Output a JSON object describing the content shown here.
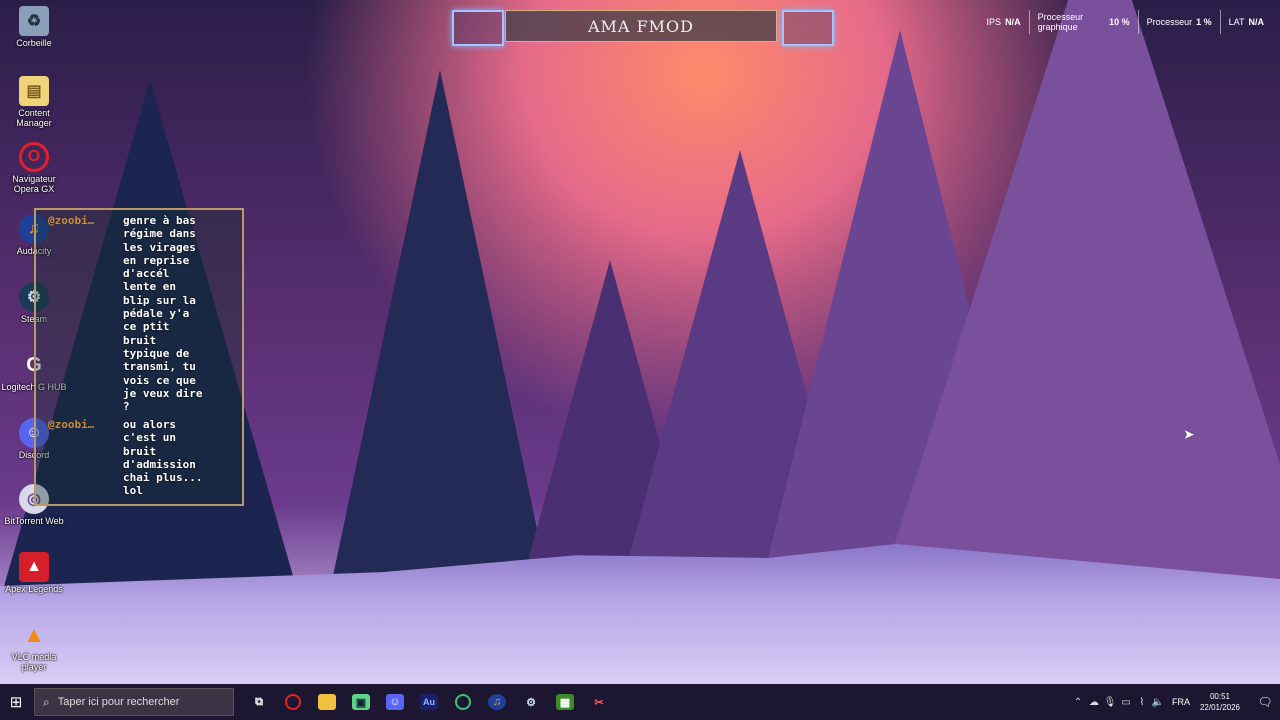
{
  "desktop_icons": [
    {
      "label": "Corbeille",
      "icon": "recycle-bin-icon"
    },
    {
      "label": "Content\nManager",
      "icon": "folder-icon"
    },
    {
      "label": "Navigateur\nOpera GX",
      "icon": "opera-gx-icon"
    },
    {
      "label": "Audacity",
      "icon": "audacity-icon"
    },
    {
      "label": "Steam",
      "icon": "steam-icon"
    },
    {
      "label": "Logitech G HUB",
      "icon": "logitech-ghub-icon"
    },
    {
      "label": "Discord",
      "icon": "discord-icon"
    },
    {
      "label": "BitTorrent Web",
      "icon": "bittorrent-icon"
    },
    {
      "label": "Apex Legends",
      "icon": "apex-legends-icon"
    },
    {
      "label": "VLC media player",
      "icon": "vlc-icon"
    }
  ],
  "hud": {
    "title": "AMA FMOD",
    "stats": [
      {
        "key": "IPS",
        "value": "N/A"
      },
      {
        "key": "Processeur\ngraphique",
        "value": "10 %"
      },
      {
        "key": "Processeur",
        "value": "1 %"
      },
      {
        "key": "LAT",
        "value": "N/A"
      }
    ]
  },
  "chat": {
    "messages": [
      {
        "user": "@zoobi…",
        "text": "genre à bas\nrégime dans\nles virages\nen reprise\nd'accél\nlente en\nblip sur la\npédale y'a\nce ptit\nbruit\ntypique de\ntransmi, tu\nvois ce que\nje veux dire\n?"
      },
      {
        "user": "@zoobi…",
        "text": "ou alors\nc'est un\nbruit\nd'admission\nchai plus...\nlol"
      }
    ]
  },
  "taskbar": {
    "search_placeholder": "Taper ici pour rechercher",
    "apps": [
      "task-view-icon",
      "opera-gx-icon",
      "file-explorer-icon",
      "xbox-icon",
      "discord-icon",
      "audition-icon",
      "spotify-icon",
      "audacity-icon",
      "steam-icon",
      "minecraft-icon",
      "capcut-icon"
    ],
    "language": "FRA",
    "time": "00:51",
    "date": "22/01/2026"
  },
  "colors": {
    "taskbar": "#1d1630",
    "hud_border": "#9fc6ff",
    "chat_border": "#b89a6a",
    "chat_user": "#c98a3a"
  }
}
